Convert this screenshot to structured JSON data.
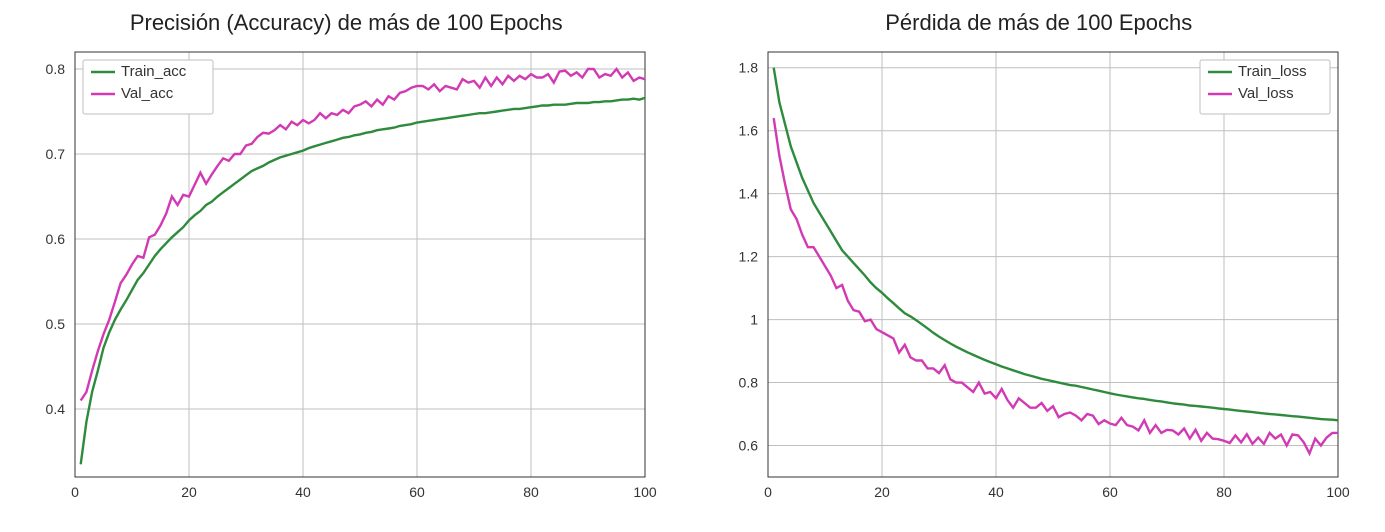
{
  "chart_data": [
    {
      "type": "line",
      "title": "Precisión (Accuracy) de más de 100 Epochs",
      "xlabel": "",
      "ylabel": "",
      "xlim": [
        0,
        100
      ],
      "ylim": [
        0.32,
        0.82
      ],
      "xticks": [
        0,
        20,
        40,
        60,
        80,
        100
      ],
      "yticks": [
        0.4,
        0.5,
        0.6,
        0.7,
        0.8
      ],
      "grid": true,
      "legend_pos": "upper-left",
      "x": [
        1,
        2,
        3,
        4,
        5,
        6,
        7,
        8,
        9,
        10,
        11,
        12,
        13,
        14,
        15,
        16,
        17,
        18,
        19,
        20,
        21,
        22,
        23,
        24,
        25,
        26,
        27,
        28,
        29,
        30,
        31,
        32,
        33,
        34,
        35,
        36,
        37,
        38,
        39,
        40,
        41,
        42,
        43,
        44,
        45,
        46,
        47,
        48,
        49,
        50,
        51,
        52,
        53,
        54,
        55,
        56,
        57,
        58,
        59,
        60,
        61,
        62,
        63,
        64,
        65,
        66,
        67,
        68,
        69,
        70,
        71,
        72,
        73,
        74,
        75,
        76,
        77,
        78,
        79,
        80,
        81,
        82,
        83,
        84,
        85,
        86,
        87,
        88,
        89,
        90,
        91,
        92,
        93,
        94,
        95,
        96,
        97,
        98,
        99,
        100
      ],
      "series": [
        {
          "name": "Train_acc",
          "color": "#2e8b3d",
          "values": [
            0.335,
            0.385,
            0.42,
            0.445,
            0.472,
            0.49,
            0.505,
            0.517,
            0.528,
            0.54,
            0.552,
            0.56,
            0.57,
            0.58,
            0.588,
            0.595,
            0.602,
            0.608,
            0.614,
            0.622,
            0.628,
            0.633,
            0.64,
            0.644,
            0.65,
            0.655,
            0.66,
            0.665,
            0.67,
            0.675,
            0.68,
            0.683,
            0.686,
            0.69,
            0.693,
            0.696,
            0.698,
            0.7,
            0.702,
            0.704,
            0.707,
            0.709,
            0.711,
            0.713,
            0.715,
            0.717,
            0.719,
            0.72,
            0.722,
            0.723,
            0.725,
            0.726,
            0.728,
            0.729,
            0.73,
            0.731,
            0.733,
            0.734,
            0.735,
            0.737,
            0.738,
            0.739,
            0.74,
            0.741,
            0.742,
            0.743,
            0.744,
            0.745,
            0.746,
            0.747,
            0.748,
            0.748,
            0.749,
            0.75,
            0.751,
            0.752,
            0.753,
            0.753,
            0.754,
            0.755,
            0.756,
            0.757,
            0.757,
            0.758,
            0.758,
            0.758,
            0.759,
            0.76,
            0.76,
            0.76,
            0.761,
            0.761,
            0.762,
            0.762,
            0.763,
            0.764,
            0.764,
            0.765,
            0.764,
            0.766
          ]
        },
        {
          "name": "Val_acc",
          "color": "#d23ab3",
          "values": [
            0.41,
            0.42,
            0.445,
            0.468,
            0.488,
            0.505,
            0.526,
            0.548,
            0.558,
            0.57,
            0.58,
            0.578,
            0.602,
            0.605,
            0.616,
            0.63,
            0.65,
            0.64,
            0.652,
            0.65,
            0.664,
            0.678,
            0.665,
            0.676,
            0.686,
            0.695,
            0.692,
            0.7,
            0.7,
            0.71,
            0.712,
            0.72,
            0.725,
            0.724,
            0.728,
            0.734,
            0.729,
            0.738,
            0.734,
            0.74,
            0.736,
            0.74,
            0.748,
            0.742,
            0.748,
            0.746,
            0.752,
            0.748,
            0.756,
            0.758,
            0.762,
            0.756,
            0.764,
            0.758,
            0.768,
            0.764,
            0.772,
            0.774,
            0.778,
            0.78,
            0.78,
            0.776,
            0.782,
            0.774,
            0.78,
            0.778,
            0.776,
            0.788,
            0.784,
            0.786,
            0.778,
            0.79,
            0.78,
            0.79,
            0.782,
            0.792,
            0.786,
            0.792,
            0.788,
            0.794,
            0.79,
            0.79,
            0.794,
            0.784,
            0.797,
            0.798,
            0.792,
            0.796,
            0.79,
            0.8,
            0.8,
            0.79,
            0.794,
            0.792,
            0.8,
            0.79,
            0.796,
            0.786,
            0.79,
            0.788
          ]
        }
      ]
    },
    {
      "type": "line",
      "title": "Pérdida de más de 100 Epochs",
      "xlabel": "",
      "ylabel": "",
      "xlim": [
        0,
        100
      ],
      "ylim": [
        0.5,
        1.85
      ],
      "xticks": [
        0,
        20,
        40,
        60,
        80,
        100
      ],
      "yticks": [
        0.6,
        0.8,
        1.0,
        1.2,
        1.4,
        1.6,
        1.8
      ],
      "grid": true,
      "legend_pos": "upper-right",
      "x": [
        1,
        2,
        3,
        4,
        5,
        6,
        7,
        8,
        9,
        10,
        11,
        12,
        13,
        14,
        15,
        16,
        17,
        18,
        19,
        20,
        21,
        22,
        23,
        24,
        25,
        26,
        27,
        28,
        29,
        30,
        31,
        32,
        33,
        34,
        35,
        36,
        37,
        38,
        39,
        40,
        41,
        42,
        43,
        44,
        45,
        46,
        47,
        48,
        49,
        50,
        51,
        52,
        53,
        54,
        55,
        56,
        57,
        58,
        59,
        60,
        61,
        62,
        63,
        64,
        65,
        66,
        67,
        68,
        69,
        70,
        71,
        72,
        73,
        74,
        75,
        76,
        77,
        78,
        79,
        80,
        81,
        82,
        83,
        84,
        85,
        86,
        87,
        88,
        89,
        90,
        91,
        92,
        93,
        94,
        95,
        96,
        97,
        98,
        99,
        100
      ],
      "series": [
        {
          "name": "Train_loss",
          "color": "#2e8b3d",
          "values": [
            1.8,
            1.69,
            1.62,
            1.55,
            1.5,
            1.45,
            1.41,
            1.37,
            1.34,
            1.31,
            1.28,
            1.25,
            1.22,
            1.2,
            1.18,
            1.16,
            1.14,
            1.118,
            1.1,
            1.085,
            1.068,
            1.052,
            1.036,
            1.02,
            1.01,
            0.998,
            0.985,
            0.972,
            0.958,
            0.946,
            0.935,
            0.924,
            0.914,
            0.905,
            0.896,
            0.888,
            0.88,
            0.872,
            0.865,
            0.858,
            0.851,
            0.845,
            0.839,
            0.833,
            0.827,
            0.822,
            0.817,
            0.812,
            0.808,
            0.804,
            0.8,
            0.796,
            0.792,
            0.79,
            0.786,
            0.782,
            0.778,
            0.774,
            0.77,
            0.766,
            0.762,
            0.759,
            0.756,
            0.753,
            0.75,
            0.748,
            0.745,
            0.742,
            0.74,
            0.737,
            0.734,
            0.732,
            0.73,
            0.727,
            0.726,
            0.724,
            0.722,
            0.72,
            0.718,
            0.716,
            0.714,
            0.712,
            0.71,
            0.708,
            0.706,
            0.704,
            0.702,
            0.7,
            0.699,
            0.697,
            0.695,
            0.693,
            0.692,
            0.69,
            0.688,
            0.686,
            0.684,
            0.683,
            0.682,
            0.68
          ]
        },
        {
          "name": "Val_loss",
          "color": "#d23ab3",
          "values": [
            1.64,
            1.52,
            1.43,
            1.35,
            1.32,
            1.27,
            1.23,
            1.23,
            1.2,
            1.17,
            1.14,
            1.1,
            1.11,
            1.06,
            1.03,
            1.025,
            0.995,
            1.0,
            0.97,
            0.96,
            0.95,
            0.94,
            0.895,
            0.92,
            0.88,
            0.87,
            0.87,
            0.845,
            0.845,
            0.83,
            0.855,
            0.81,
            0.8,
            0.8,
            0.785,
            0.77,
            0.8,
            0.765,
            0.77,
            0.75,
            0.78,
            0.745,
            0.72,
            0.75,
            0.735,
            0.72,
            0.72,
            0.735,
            0.71,
            0.725,
            0.69,
            0.7,
            0.705,
            0.695,
            0.68,
            0.7,
            0.695,
            0.668,
            0.68,
            0.67,
            0.665,
            0.688,
            0.665,
            0.66,
            0.648,
            0.68,
            0.64,
            0.665,
            0.64,
            0.65,
            0.648,
            0.635,
            0.654,
            0.622,
            0.65,
            0.615,
            0.64,
            0.622,
            0.62,
            0.615,
            0.608,
            0.632,
            0.61,
            0.636,
            0.605,
            0.625,
            0.605,
            0.64,
            0.622,
            0.635,
            0.6,
            0.635,
            0.632,
            0.61,
            0.575,
            0.622,
            0.6,
            0.625,
            0.64,
            0.64
          ]
        }
      ]
    }
  ]
}
